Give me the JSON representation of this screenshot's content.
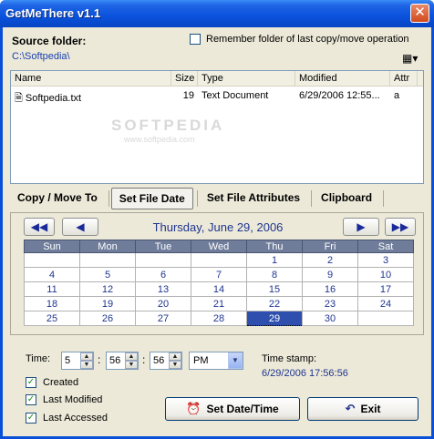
{
  "app": {
    "title": "GetMeThere v1.1",
    "close_glyph": "✕"
  },
  "source": {
    "label": "Source folder:",
    "path": "C:\\Softpedia\\",
    "remember_label": "Remember folder of last copy/move operation",
    "remember_checked": false,
    "view_icon": "view-menu-icon"
  },
  "filelist": {
    "columns": [
      "Name",
      "Size",
      "Type",
      "Modified",
      "Attr"
    ],
    "rows": [
      {
        "name": "Softpedia.txt",
        "size": "19",
        "type": "Text Document",
        "modified": "6/29/2006 12:55...",
        "attr": "a"
      }
    ],
    "watermark": "SOFTPEDIA",
    "watermark_url": "www.softpedia.com"
  },
  "tabs": [
    "Copy / Move To",
    "Set File Date",
    "Set File Attributes",
    "Clipboard"
  ],
  "active_tab": 1,
  "calendar": {
    "title": "Thursday, June 29, 2006",
    "nav": {
      "prev_year": "◀◀",
      "prev_month": "◀",
      "next_month": "▶",
      "next_year": "▶▶"
    },
    "weekdays": [
      "Sun",
      "Mon",
      "Tue",
      "Wed",
      "Thu",
      "Fri",
      "Sat"
    ],
    "weeks": [
      [
        "",
        "",
        "",
        "",
        "1",
        "2",
        "3"
      ],
      [
        "4",
        "5",
        "6",
        "7",
        "8",
        "9",
        "10"
      ],
      [
        "11",
        "12",
        "13",
        "14",
        "15",
        "16",
        "17"
      ],
      [
        "18",
        "19",
        "20",
        "21",
        "22",
        "23",
        "24"
      ],
      [
        "25",
        "26",
        "27",
        "28",
        "29",
        "30",
        ""
      ]
    ],
    "selected_day": "29"
  },
  "time": {
    "label": "Time:",
    "hour": "5",
    "minute": "56",
    "second": "56",
    "separator": ":",
    "ampm": "PM"
  },
  "timestamp": {
    "label": "Time stamp:",
    "value": "6/29/2006 17:56:56"
  },
  "options": [
    {
      "label": "Created",
      "checked": true
    },
    {
      "label": "Last Modified",
      "checked": true
    },
    {
      "label": "Last Accessed",
      "checked": true
    }
  ],
  "buttons": {
    "set": "Set Date/Time",
    "exit": "Exit"
  }
}
